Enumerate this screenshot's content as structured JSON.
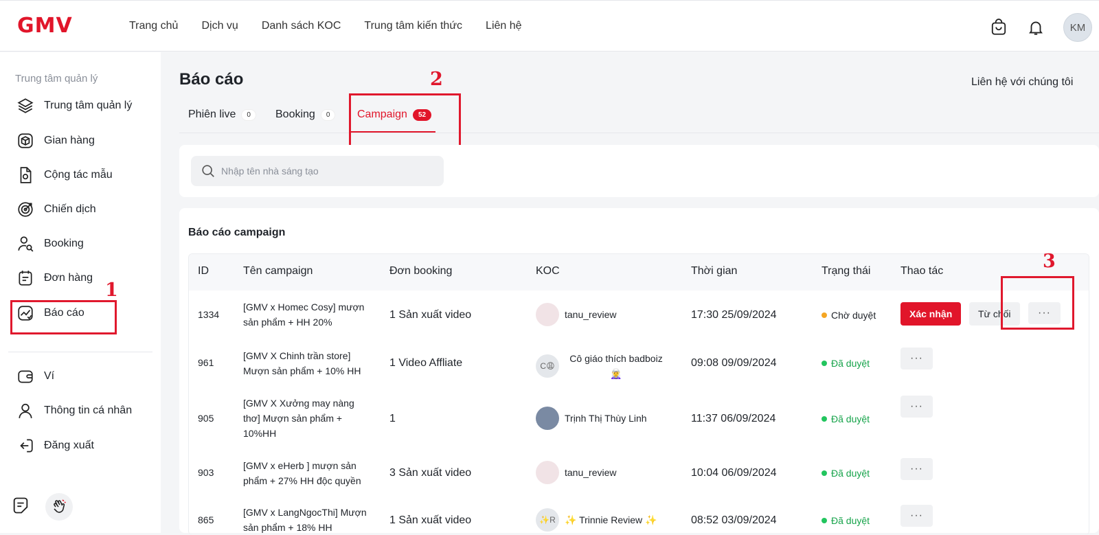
{
  "brand": "GMV",
  "nav": [
    "Trang chủ",
    "Dịch vụ",
    "Danh sách KOC",
    "Trung tâm kiến thức",
    "Liên hệ"
  ],
  "user_initials": "KM",
  "sidebar": {
    "header": "Trung tâm quản lý",
    "items": [
      {
        "label": "Trung tâm quản lý",
        "icon": "layers-icon"
      },
      {
        "label": "Gian hàng",
        "icon": "box-icon"
      },
      {
        "label": "Cộng tác mẫu",
        "icon": "sample-doc-icon"
      },
      {
        "label": "Chiến dịch",
        "icon": "target-icon"
      },
      {
        "label": "Booking",
        "icon": "user-search-icon"
      },
      {
        "label": "Đơn hàng",
        "icon": "calendar-list-icon"
      },
      {
        "label": "Báo cáo",
        "icon": "report-chart-icon"
      },
      {
        "label": "Ví",
        "icon": "wallet-icon"
      },
      {
        "label": "Thông tin cá nhân",
        "icon": "person-icon"
      },
      {
        "label": "Đăng xuất",
        "icon": "logout-icon"
      }
    ]
  },
  "annotations": [
    "1",
    "2",
    "3"
  ],
  "page": {
    "title": "Báo cáo",
    "contact": "Liên hệ với chúng tôi",
    "tabs": [
      {
        "label": "Phiên live",
        "count": "0"
      },
      {
        "label": "Booking",
        "count": "0"
      },
      {
        "label": "Campaign",
        "count": "52"
      }
    ],
    "search_placeholder": "Nhập tên nhà sáng tạo"
  },
  "table": {
    "title": "Báo cáo campaign",
    "headers": [
      "ID",
      "Tên campaign",
      "Đơn booking",
      "KOC",
      "Thời gian",
      "Trạng thái",
      "Thao tác"
    ],
    "rows": [
      {
        "id": "1334",
        "name": "[GMV x Homec Cosy] mượn sản phẩm + HH 20%",
        "booking": "1 Sản xuất video",
        "koc": "tanu_review",
        "avatar": "",
        "time": "17:30 25/09/2024",
        "status": "Chờ duyệt"
      },
      {
        "id": "961",
        "name": "[GMV X Chinh trần store] Mượn sản phẩm + 10% HH",
        "booking": "1 Video Affliate",
        "koc": "Cô giáo thích badboiz 🧝‍♀️",
        "avatar": "C😩",
        "time": "09:08 09/09/2024",
        "status": "Đã duyệt"
      },
      {
        "id": "905",
        "name": "[GMV X Xưởng may nàng thơ] Mượn sản phẩm + 10%HH",
        "booking": "1",
        "koc": "Trịnh Thị Thùy Linh",
        "avatar": "",
        "time": "11:37 06/09/2024",
        "status": "Đã duyệt"
      },
      {
        "id": "903",
        "name": "[GMV x eHerb ] mượn sản phẩm + 27% HH độc quyền",
        "booking": "3 Sản xuất video",
        "koc": "tanu_review",
        "avatar": "",
        "time": "10:04 06/09/2024",
        "status": "Đã duyệt"
      },
      {
        "id": "865",
        "name": "[GMV x LangNgocThi] Mượn sản phẩm + 18% HH",
        "booking": "1 Sản xuất video",
        "koc": "✨ Trinnie Review ✨",
        "avatar": "✨R",
        "time": "08:52 03/09/2024",
        "status": "Đã duyệt"
      }
    ],
    "actions": {
      "confirm": "Xác nhận",
      "reject": "Từ chối",
      "more": "···"
    }
  },
  "colors": {
    "brand": "#e1152a",
    "pending": "#f5a623",
    "approved": "#22c55e",
    "approved_text": "#16a34a"
  }
}
